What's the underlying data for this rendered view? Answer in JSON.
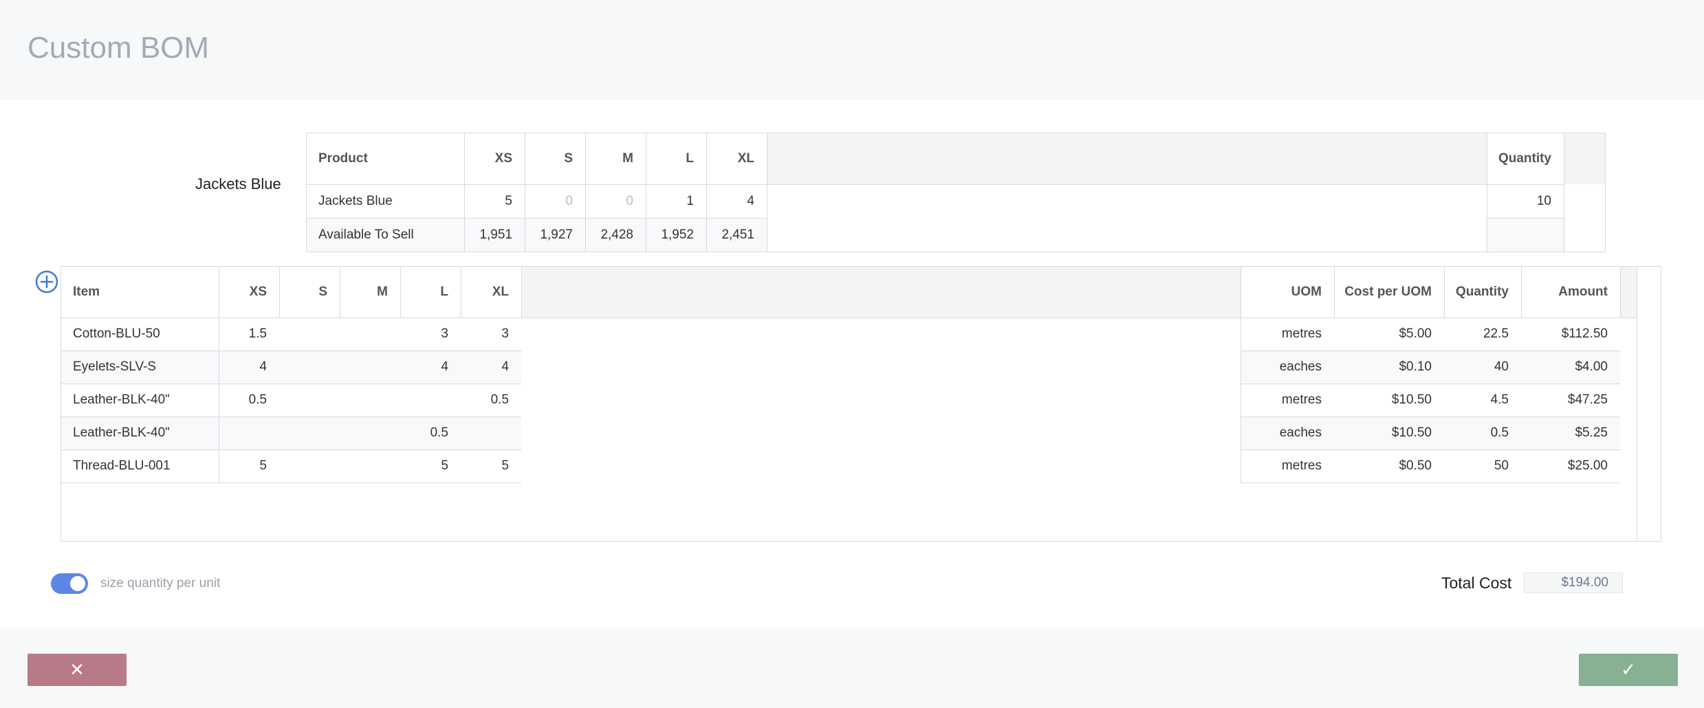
{
  "header": {
    "title": "Custom BOM"
  },
  "product_section": {
    "label": "Jackets Blue",
    "columns": [
      "Product",
      "XS",
      "S",
      "M",
      "L",
      "XL",
      "Quantity"
    ],
    "rows": [
      {
        "label": "Jackets Blue",
        "sizes": [
          "5",
          "0",
          "0",
          "1",
          "4"
        ],
        "quantity": "10"
      },
      {
        "label": "Available To Sell",
        "sizes": [
          "1,951",
          "1,927",
          "2,428",
          "1,952",
          "2,451"
        ],
        "quantity": ""
      }
    ]
  },
  "bom_table": {
    "columns": {
      "item": "Item",
      "sizes": [
        "XS",
        "S",
        "M",
        "L",
        "XL"
      ],
      "uom": "UOM",
      "cost_per_uom": "Cost per UOM",
      "quantity": "Quantity",
      "amount": "Amount"
    },
    "rows": [
      {
        "item": "Cotton-BLU-50",
        "sizes": [
          "1.5",
          "",
          "",
          "3",
          "3"
        ],
        "uom": "metres",
        "cost": "$5.00",
        "quantity": "22.5",
        "amount": "$112.50"
      },
      {
        "item": "Eyelets-SLV-S",
        "sizes": [
          "4",
          "",
          "",
          "4",
          "4"
        ],
        "uom": "eaches",
        "cost": "$0.10",
        "quantity": "40",
        "amount": "$4.00"
      },
      {
        "item": "Leather-BLK-40\"",
        "sizes": [
          "0.5",
          "",
          "",
          "",
          "0.5"
        ],
        "uom": "metres",
        "cost": "$10.50",
        "quantity": "4.5",
        "amount": "$47.25"
      },
      {
        "item": "Leather-BLK-40\"",
        "sizes": [
          "",
          "",
          "",
          "0.5",
          ""
        ],
        "uom": "eaches",
        "cost": "$10.50",
        "quantity": "0.5",
        "amount": "$5.25"
      },
      {
        "item": "Thread-BLU-001",
        "sizes": [
          "5",
          "",
          "",
          "5",
          "5"
        ],
        "uom": "metres",
        "cost": "$0.50",
        "quantity": "50",
        "amount": "$25.00"
      }
    ]
  },
  "options": {
    "toggle_label": "size quantity per unit",
    "toggle_on": true
  },
  "totals": {
    "label": "Total Cost",
    "value": "$194.00"
  },
  "actions": {
    "cancel_icon": "close-icon",
    "confirm_icon": "check-icon"
  },
  "colors": {
    "cancel": "#b87b85",
    "confirm": "#86b193",
    "toggle": "#5b86e5",
    "add_icon": "#3a7bd5"
  }
}
